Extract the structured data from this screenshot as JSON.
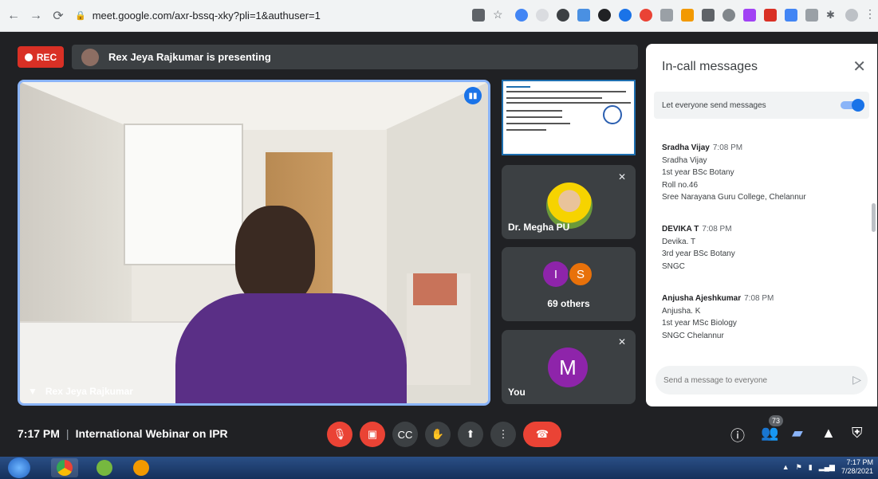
{
  "browser": {
    "url": "meet.google.com/axr-bssq-xky?pli=1&authuser=1"
  },
  "meeting": {
    "rec_label": "REC",
    "presenting_text": "Rex Jeya Rajkumar is presenting",
    "main_speaker_name": "Rex Jeya Rajkumar",
    "time": "7:17 PM",
    "title": "International Webinar on IPR"
  },
  "tiles": [
    {
      "name": "Dr. Megha PU"
    },
    {
      "avatar_letters": [
        "I",
        "S"
      ],
      "label": "69 others"
    },
    {
      "avatar_letter": "M",
      "name": "You"
    }
  ],
  "chat": {
    "title": "In-call messages",
    "toggle_label": "Let everyone send messages",
    "messages": [
      {
        "sender": "Sradha Vijay",
        "time": "7:08 PM",
        "lines": [
          "Sradha Vijay",
          "1st year BSc Botany",
          "Roll no.46",
          "Sree Narayana Guru College, Chelannur"
        ]
      },
      {
        "sender": "DEVIKA T",
        "time": "7:08 PM",
        "lines": [
          "Devika. T",
          "3rd year BSc Botany",
          "SNGC"
        ]
      },
      {
        "sender": "Anjusha Ajeshkumar",
        "time": "7:08 PM",
        "lines": [
          "Anjusha. K",
          "1st year MSc Biology",
          "SNGC Chelannur"
        ]
      }
    ],
    "input_placeholder": "Send a message to everyone"
  },
  "controls": {
    "people_count": "73"
  },
  "taskbar": {
    "clock_time": "7:17 PM",
    "clock_date": "7/28/2021"
  },
  "colors": {
    "meet_bg": "#202124",
    "accent_blue": "#1a73e8",
    "end_call_red": "#ea4335",
    "chat_bg": "#ffffff"
  }
}
